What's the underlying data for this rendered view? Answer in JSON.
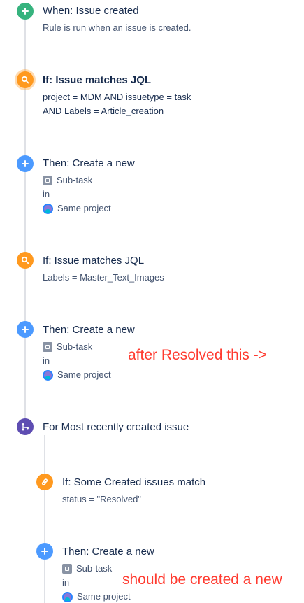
{
  "colors": {
    "trigger": "#36B37E",
    "condition": "#FF991F",
    "action": "#4C9AFF",
    "branch": "#5E4DB2",
    "annotation": "#FF3B30"
  },
  "trigger": {
    "icon": "plus-icon",
    "title": "When: Issue created",
    "description": "Rule is run when an issue is created."
  },
  "condition_1": {
    "icon": "search-icon",
    "title": "If: Issue matches JQL",
    "jql_line_1": "project = MDM AND issuetype = task",
    "jql_line_2": "AND Labels = Article_creation"
  },
  "action_1": {
    "icon": "plus-icon",
    "title": "Then: Create a new",
    "issue_type": "Sub-task",
    "in_label": "in",
    "project": "Same project"
  },
  "condition_2": {
    "icon": "search-icon",
    "title": "If: Issue matches JQL",
    "jql_line_1": "Labels = Master_Text_Images"
  },
  "action_2": {
    "icon": "plus-icon",
    "title": "Then: Create a new",
    "issue_type": "Sub-task",
    "in_label": "in",
    "project": "Same project"
  },
  "branch": {
    "icon": "branch-icon",
    "title": "For Most recently created issue"
  },
  "branch_condition": {
    "icon": "link-icon",
    "title": "If: Some Created issues match",
    "jql_line_1": "status = \"Resolved\""
  },
  "action_3": {
    "icon": "plus-icon",
    "title": "Then: Create a new",
    "issue_type": "Sub-task",
    "in_label": "in",
    "project": "Same project"
  },
  "annotations": {
    "note_1": "after Resolved this ->",
    "note_2": "should be created a new"
  }
}
